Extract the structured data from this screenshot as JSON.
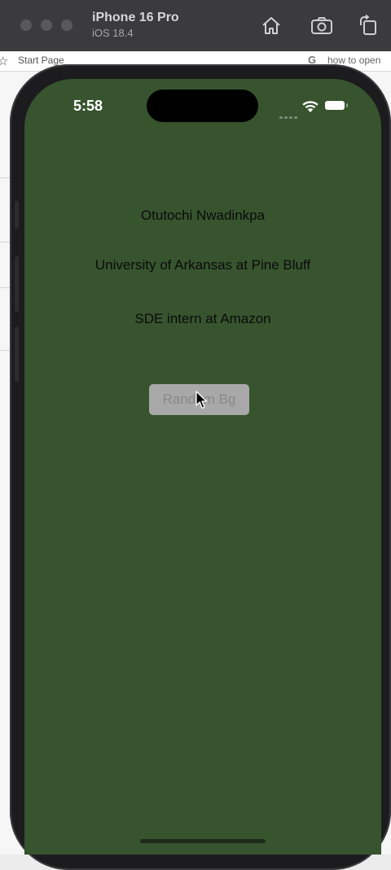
{
  "simulator": {
    "device_name": "iPhone 16 Pro",
    "os_version": "iOS 18.4",
    "toolbar_icons": [
      "home-icon",
      "screenshot-icon",
      "rotate-icon"
    ]
  },
  "background_browser": {
    "bookmark_label": "Start Page",
    "search_snippet": "how to open"
  },
  "status_bar": {
    "time": "5:58"
  },
  "app": {
    "background_color": "#37542e",
    "name_text": "Otutochi Nwadinkpa",
    "school_text": "University of Arkansas at Pine Bluff",
    "role_text": "SDE intern at Amazon",
    "button_label": "Random Bg"
  }
}
